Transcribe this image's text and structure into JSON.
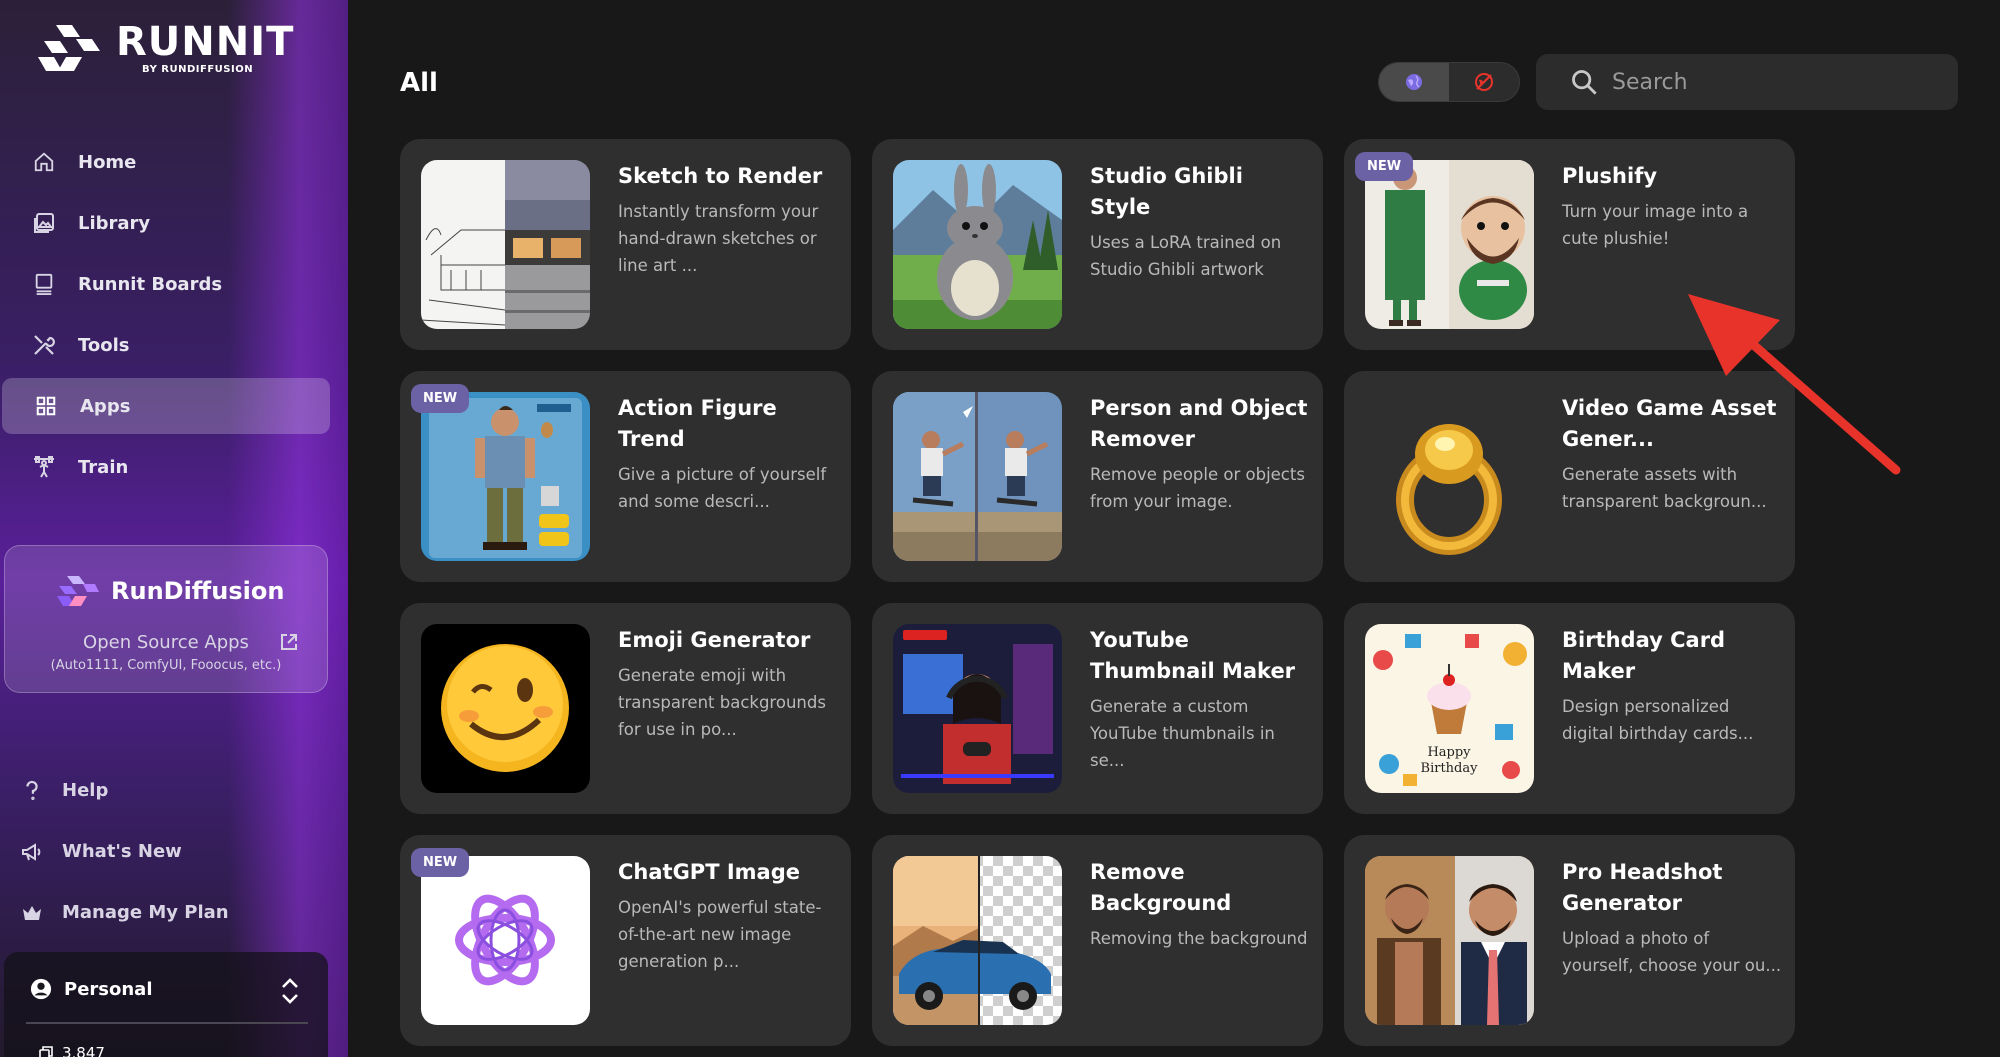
{
  "brand": {
    "name": "RUNNIT",
    "sub": "BY RUNDIFFUSION"
  },
  "nav": [
    {
      "label": "Home",
      "icon": "home-icon"
    },
    {
      "label": "Library",
      "icon": "library-icon"
    },
    {
      "label": "Runnit Boards",
      "icon": "boards-icon"
    },
    {
      "label": "Tools",
      "icon": "tools-icon"
    },
    {
      "label": "Apps",
      "icon": "apps-grid-icon",
      "active": true
    },
    {
      "label": "Train",
      "icon": "train-icon"
    }
  ],
  "rundiffusion": {
    "title": "RunDiffusion",
    "subtitle": "Open Source Apps",
    "detail": "(Auto1111, ComfyUI, Fooocus, etc.)"
  },
  "bottom_nav": [
    {
      "label": "Help",
      "icon": "help-icon"
    },
    {
      "label": "What's New",
      "icon": "megaphone-icon"
    },
    {
      "label": "Manage My Plan",
      "icon": "crown-icon"
    }
  ],
  "account": {
    "name": "Personal",
    "credits": "3,847"
  },
  "main": {
    "title": "All",
    "search_placeholder": "Search",
    "apps": [
      {
        "title": "Sketch to Render",
        "desc": "Instantly transform your hand-drawn sketches or line art ...",
        "thumb": "sketch",
        "new": false
      },
      {
        "title": "Studio Ghibli Style",
        "desc": "Uses a LoRA trained on Studio Ghibli artwork",
        "thumb": "ghibli",
        "new": false
      },
      {
        "title": "Plushify",
        "desc": "Turn your image into a cute plushie!",
        "thumb": "plush",
        "new": true
      },
      {
        "title": "Action Figure Trend",
        "desc": "Give a picture of yourself and some descri...",
        "thumb": "figure",
        "new": true
      },
      {
        "title": "Person and Object Remover",
        "desc": "Remove people or objects from your image.",
        "thumb": "skate",
        "new": false
      },
      {
        "title": "Video Game Asset Gener...",
        "desc": "Generate assets with transparent backgroun...",
        "thumb": "ring",
        "new": false
      },
      {
        "title": "Emoji Generator",
        "desc": "Generate emoji with transparent backgrounds for use in po...",
        "thumb": "emoji",
        "new": false
      },
      {
        "title": "YouTube Thumbnail Maker",
        "desc": "Generate a custom YouTube thumbnails in se...",
        "thumb": "youtube",
        "new": false
      },
      {
        "title": "Birthday Card Maker",
        "desc": "Design personalized digital birthday cards...",
        "thumb": "birthday",
        "new": false
      },
      {
        "title": "ChatGPT Image",
        "desc": "OpenAI's powerful state-of-the-art new image generation p...",
        "thumb": "openai",
        "new": true
      },
      {
        "title": "Remove Background",
        "desc": "Removing the background",
        "thumb": "car",
        "new": false
      },
      {
        "title": "Pro Headshot Generator",
        "desc": "Upload a photo of yourself, choose your ou...",
        "thumb": "headshot",
        "new": false
      }
    ],
    "badge_label": "NEW"
  },
  "colors": {
    "accent": "#6b62a6",
    "arrow": "#e8332a",
    "card": "#2f2f2f"
  }
}
